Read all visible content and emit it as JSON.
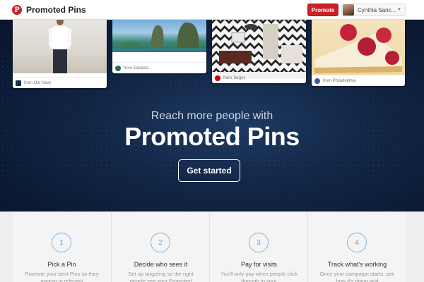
{
  "header": {
    "logo_letter": "P",
    "title": "Promoted Pins",
    "promote_label": "Promote",
    "user_name": "Cynthia Sanc...",
    "chevron": "▼"
  },
  "pins": [
    {
      "source": "from Old Navy",
      "source_icon": "old-navy-icon"
    },
    {
      "source": "from Expedia",
      "source_icon": "expedia-icon"
    },
    {
      "source": "from Target",
      "source_icon": "target-icon"
    },
    {
      "source": "from Philadelphia",
      "source_icon": "philadelphia-icon"
    }
  ],
  "hero": {
    "subtitle": "Reach more people with",
    "title": "Promoted Pins",
    "cta_label": "Get started"
  },
  "steps": [
    {
      "number": "1",
      "title": "Pick a Pin",
      "desc": "Promote your best Pins so they appear in relevant"
    },
    {
      "number": "2",
      "title": "Decide who sees it",
      "desc": "Set up targeting so the right people see your Promoted"
    },
    {
      "number": "3",
      "title": "Pay for visits",
      "desc": "You'll only pay when people click through to your"
    },
    {
      "number": "4",
      "title": "Track what's working",
      "desc": "Once your campaign starts, see how it's doing and"
    }
  ],
  "colors": {
    "brand_red": "#cb2027",
    "hero_navy": "#112544",
    "step_accent": "#5aa2e0"
  }
}
